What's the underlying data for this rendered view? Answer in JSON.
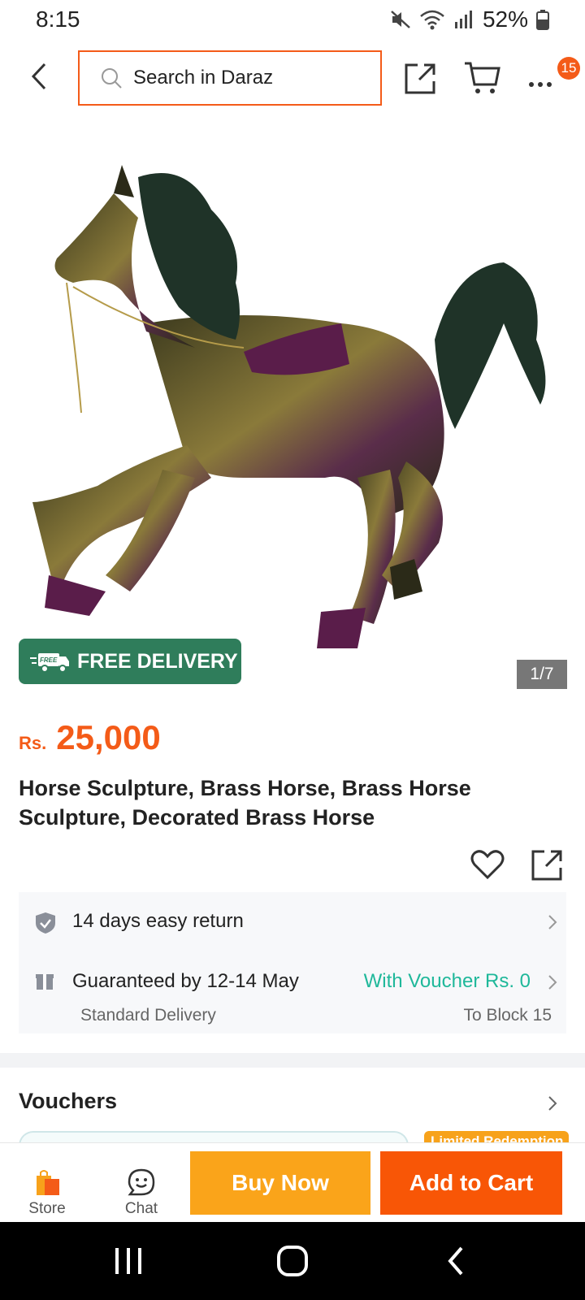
{
  "status_bar": {
    "time": "8:15",
    "battery": "52%"
  },
  "header": {
    "search_placeholder": "Search in Daraz",
    "cart_badge": "15"
  },
  "gallery": {
    "free_delivery_label": "FREE DELIVERY",
    "free_tag": "FREE",
    "counter": "1/7"
  },
  "product": {
    "currency": "Rs.",
    "price": "25,000",
    "title": "Horse Sculpture, Brass Horse, Brass Horse Sculpture, Decorated Brass Horse"
  },
  "service": {
    "return_text": "14 days easy return",
    "delivery_text": "Guaranteed by 12-14 May",
    "delivery_sub": "Standard Delivery",
    "voucher_text": "With Voucher Rs. 0",
    "block_text": "To Block 15"
  },
  "vouchers": {
    "heading": "Vouchers",
    "peek_label": "Limited Redemption"
  },
  "action_bar": {
    "store_label": "Store",
    "chat_label": "Chat",
    "buy_label": "Buy Now",
    "cart_label": "Add to Cart"
  },
  "colors": {
    "brand_orange": "#f85606",
    "buy_yellow": "#faa41a",
    "delivery_green": "#2f7d5b",
    "voucher_teal": "#1fb89a"
  }
}
